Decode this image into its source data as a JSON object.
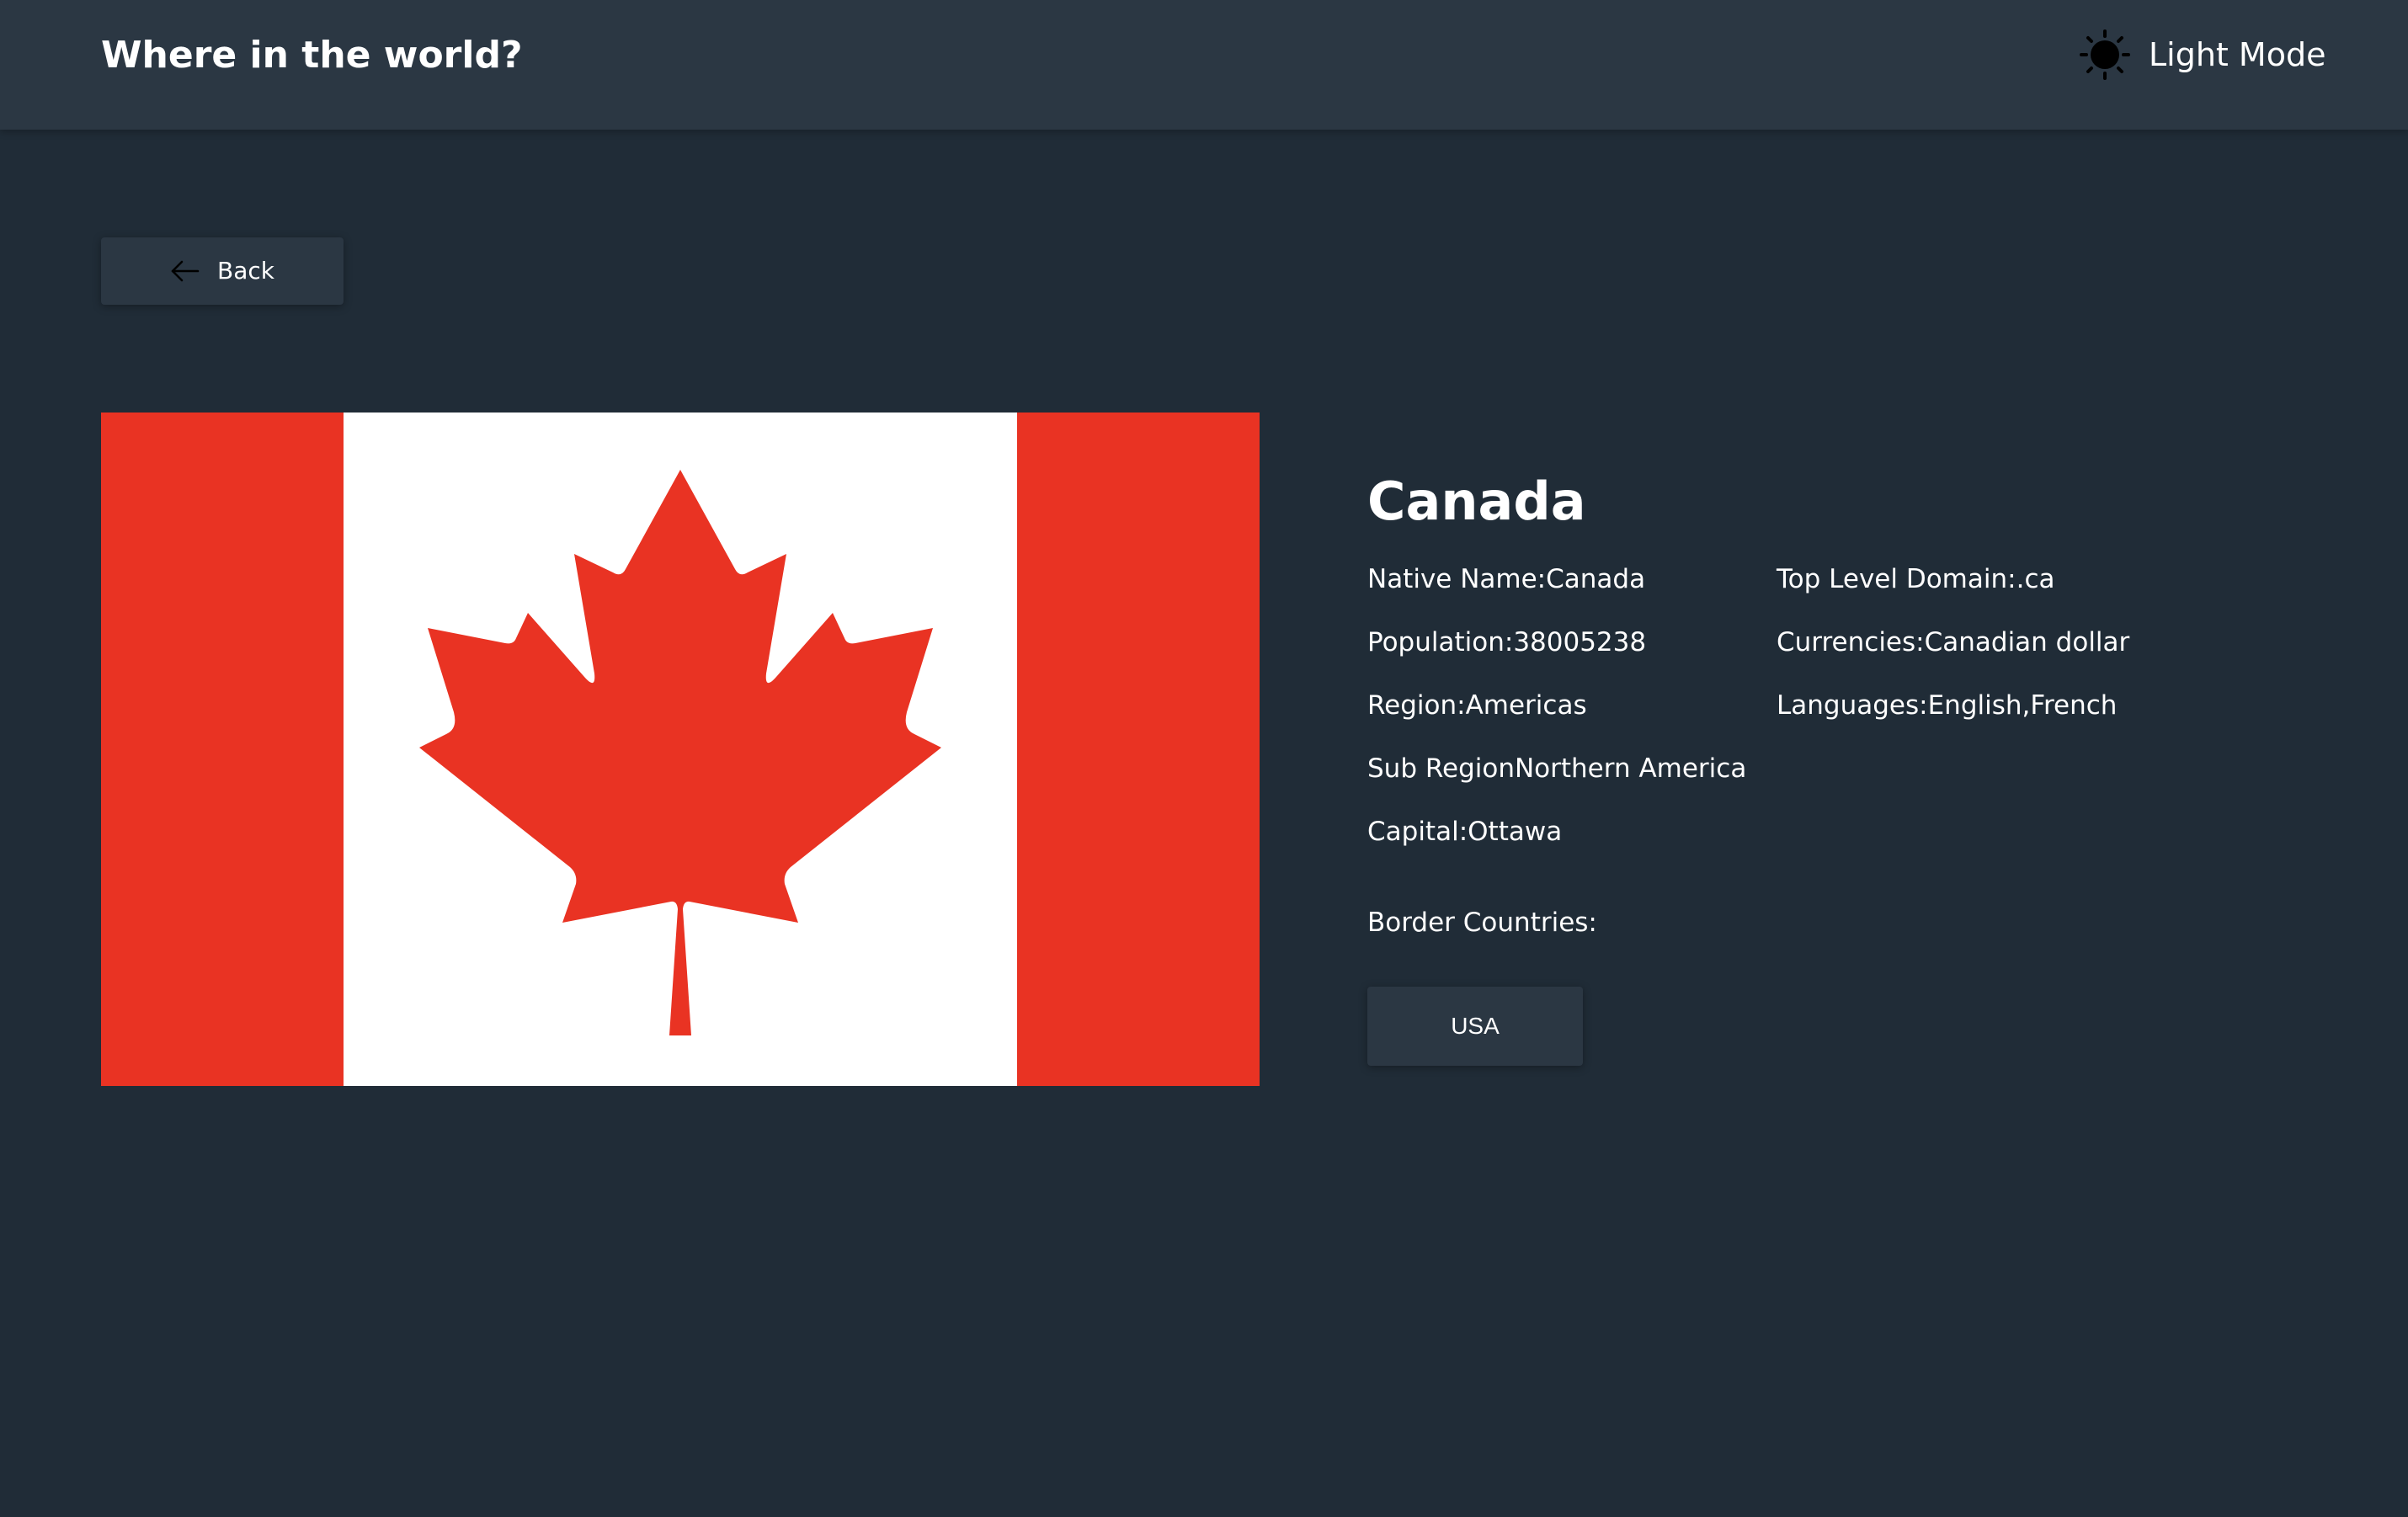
{
  "header": {
    "title": "Where in the world?",
    "mode_label": "Light Mode",
    "mode_icon": "sun-icon"
  },
  "back": {
    "label": "Back",
    "icon": "arrow-left-icon"
  },
  "flag": {
    "icon": "canada-flag",
    "colors": {
      "red": "#e93323",
      "white": "#ffffff"
    }
  },
  "country": {
    "name": "Canada",
    "left_column": [
      "Native Name:Canada",
      "Population:38005238",
      "Region:Americas",
      "Sub RegionNorthern America",
      "Capital:Ottawa"
    ],
    "right_column": [
      "Top Level Domain:.ca",
      "Currencies:Canadian dollar",
      "Languages:English,French"
    ],
    "border_title": "Border Countries:",
    "borders": [
      "USA"
    ]
  },
  "colors": {
    "background": "#202c37",
    "elements": "#2b3743",
    "text": "#ffffff"
  }
}
